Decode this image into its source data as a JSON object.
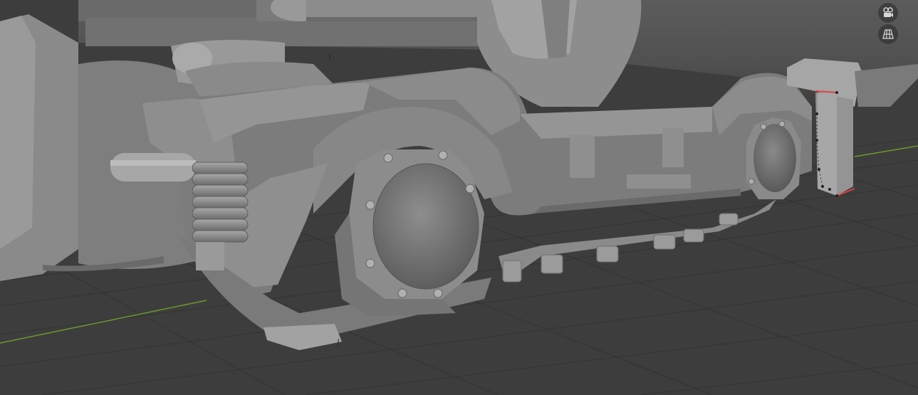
{
  "viewport": {
    "type": "3d-viewport",
    "shading": "solid",
    "background_color": "#3d3d3d",
    "grid_color": "#303030",
    "x_axis_color": "#c7434a",
    "y_axis_color": "#6a9a2a",
    "selection_edge_color": "#e04040"
  },
  "gizmos": [
    {
      "name": "camera-view-toggle",
      "icon": "camera-icon",
      "tooltip": ""
    },
    {
      "name": "ortho-persp-toggle",
      "icon": "grid-perspective-icon",
      "tooltip": ""
    }
  ]
}
